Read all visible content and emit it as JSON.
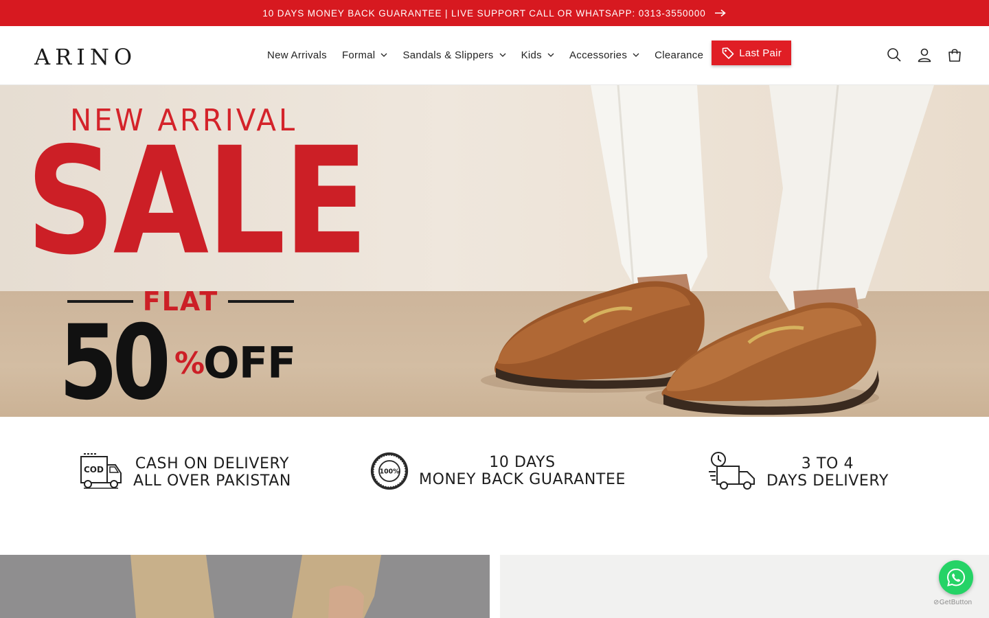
{
  "announcement": {
    "text": "10 DAYS MONEY BACK GUARANTEE | LIVE SUPPORT CALL OR WHATSAPP: 0313-3550000",
    "icon": "arrow-right-icon",
    "bg_color": "#d71920"
  },
  "header": {
    "logo": "ARINO",
    "nav": [
      {
        "label": "New Arrivals",
        "dropdown": false
      },
      {
        "label": "Formal",
        "dropdown": true
      },
      {
        "label": "Sandals & Slippers",
        "dropdown": true
      },
      {
        "label": "Kids",
        "dropdown": true
      },
      {
        "label": "Accessories",
        "dropdown": true
      },
      {
        "label": "Clearance",
        "dropdown": false
      }
    ],
    "highlight": {
      "label": "Last Pair",
      "icon": "tag-icon",
      "color": "#e01e25"
    },
    "icons": [
      "search-icon",
      "account-icon",
      "cart-icon"
    ]
  },
  "hero": {
    "line1": "NEW ARRIVAL",
    "line2": "SALE",
    "line3": "FLAT",
    "line4": "50",
    "percent": "%",
    "off": "OFF",
    "accent_color": "#cc1f26"
  },
  "features": [
    {
      "icon": "cod-truck-icon",
      "line1": "CASH ON DELIVERY",
      "line2": "ALL OVER PAKISTAN",
      "badge": "COD"
    },
    {
      "icon": "money-back-seal-icon",
      "line1": "10 DAYS",
      "line2": "MONEY BACK GUARANTEE",
      "badge": "100%"
    },
    {
      "icon": "delivery-truck-clock-icon",
      "line1": "3 TO 4",
      "line2": "DAYS DELIVERY"
    }
  ],
  "whatsapp": {
    "icon": "whatsapp-icon",
    "credit": "GetButton",
    "color": "#25d366"
  }
}
